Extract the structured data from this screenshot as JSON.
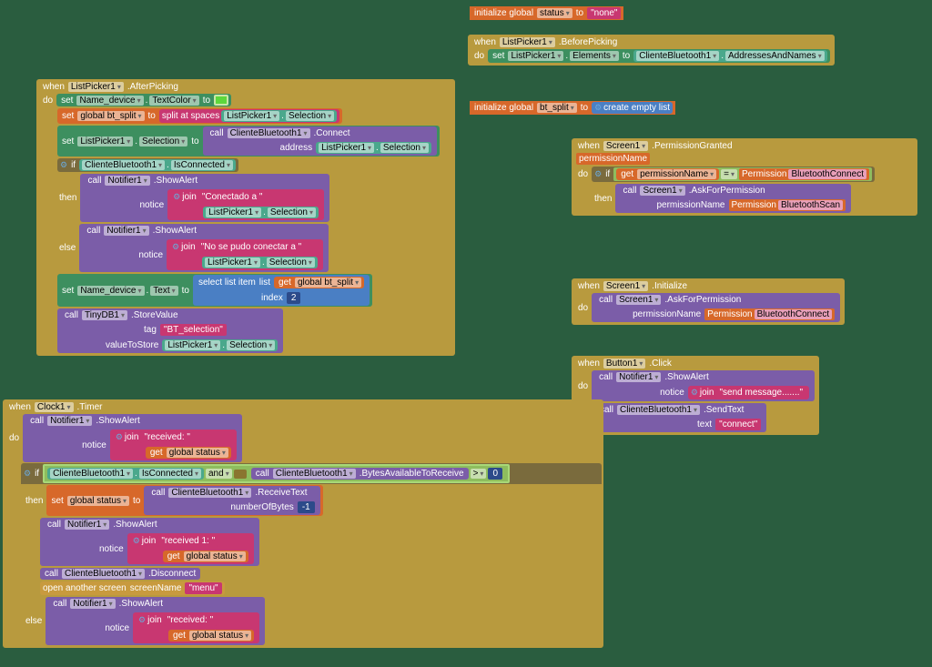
{
  "kw": {
    "when": "when",
    "do": "do",
    "set": "set",
    "to": "to",
    "call": "call",
    "if": "if",
    "then": "then",
    "else": "else",
    "get": "get",
    "initglobal": "initialize global",
    "and": "and"
  },
  "comp": {
    "list": "ListPicker1",
    "btc": "ClienteBluetooth1",
    "not": "Notifier1",
    "scr": "Screen1",
    "btn": "Button1",
    "clk": "Clock1",
    "tdb": "TinyDB1",
    "namedev": "Name_device"
  },
  "prop": {
    "beforepick": ".BeforePicking",
    "afterpick": ".AfterPicking",
    "elements": "Elements",
    "addr": "AddressesAndNames",
    "textcolor": "TextColor",
    "selection": "Selection",
    "isconn": "IsConnected",
    "text": "Text",
    "permg": ".PermissionGranted",
    "init": ".Initialize",
    "click": ".Click",
    "timer": ".Timer",
    "bytes": ".BytesAvailableToReceive"
  },
  "meth": {
    "connect": ".Connect",
    "showalert": ".ShowAlert",
    "askperm": ".AskForPermission",
    "sendtext": ".SendText",
    "recvtext": ".ReceiveText",
    "disc": ".Disconnect",
    "store": ".StoreValue"
  },
  "arg": {
    "address": "address",
    "notice": "notice",
    "permname": "permissionName",
    "text": "text",
    "numbytes": "numberOfBytes",
    "tag": "tag",
    "valstore": "valueToStore",
    "list": "list",
    "index": "index",
    "screenname": "screenName"
  },
  "var": {
    "status": "status",
    "btsplit": "bt_split",
    "globalstatus": "global status",
    "globalbtsplit": "global bt_split",
    "permname": "permissionName"
  },
  "str": {
    "none": "none",
    "conectado": "Conectado a ",
    "nopudo": "No se pudo conectar a ",
    "btsel": "BT_selection",
    "sendmsg": "send message.......",
    "connect": "connect",
    "received": "received: ",
    "received1": "received 1: ",
    "menu": "menu"
  },
  "fn": {
    "join": "join",
    "splitspaces": "split at spaces",
    "selectitem": "select list item",
    "emptylist": "create empty list",
    "openscreen": "open another screen"
  },
  "op": {
    "eq": "=",
    "gt": ">"
  },
  "num": {
    "two": "2",
    "neg1": "-1",
    "zero": "0"
  },
  "perm": {
    "label": "Permission",
    "btconn": "BluetoothConnect",
    "btscan": "BluetoothScan"
  }
}
